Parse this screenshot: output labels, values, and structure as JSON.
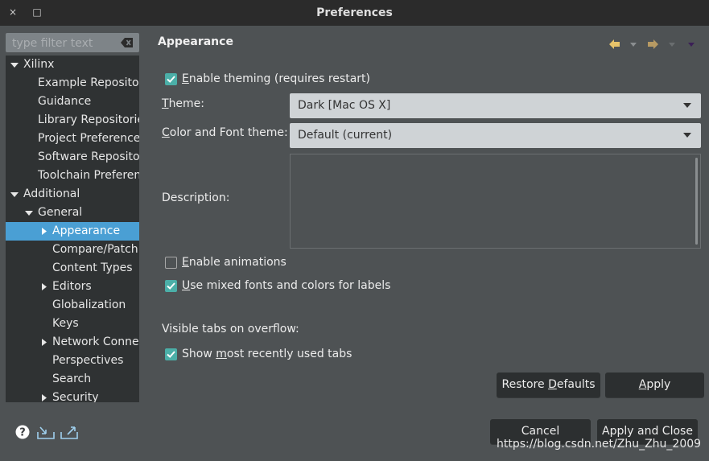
{
  "window": {
    "title": "Preferences",
    "close_symbol": "×",
    "max_symbol": "□"
  },
  "filter": {
    "placeholder": "type filter text"
  },
  "tree": [
    {
      "label": "Xilinx",
      "level": 0,
      "expander": "expanded"
    },
    {
      "label": "Example Repositor",
      "level": 1,
      "expander": "none"
    },
    {
      "label": "Guidance",
      "level": 1,
      "expander": "none"
    },
    {
      "label": "Library Repositorie",
      "level": 1,
      "expander": "none"
    },
    {
      "label": "Project Preference",
      "level": 1,
      "expander": "none"
    },
    {
      "label": "Software Reposito",
      "level": 1,
      "expander": "none"
    },
    {
      "label": "Toolchain Preferen",
      "level": 1,
      "expander": "none"
    },
    {
      "label": "Additional",
      "level": 0,
      "expander": "expanded"
    },
    {
      "label": "General",
      "level": 1,
      "expander": "expanded"
    },
    {
      "label": "Appearance",
      "level": 2,
      "expander": "collapsed",
      "selected": true
    },
    {
      "label": "Compare/Patch",
      "level": 2,
      "expander": "none"
    },
    {
      "label": "Content Types",
      "level": 2,
      "expander": "none"
    },
    {
      "label": "Editors",
      "level": 2,
      "expander": "collapsed"
    },
    {
      "label": "Globalization",
      "level": 2,
      "expander": "none"
    },
    {
      "label": "Keys",
      "level": 2,
      "expander": "none"
    },
    {
      "label": "Network Connec",
      "level": 2,
      "expander": "collapsed"
    },
    {
      "label": "Perspectives",
      "level": 2,
      "expander": "none"
    },
    {
      "label": "Search",
      "level": 2,
      "expander": "none"
    },
    {
      "label": "Security",
      "level": 2,
      "expander": "collapsed"
    }
  ],
  "page": {
    "title": "Appearance",
    "enable_theming": {
      "mnemonic": "E",
      "rest": "nable theming (requires restart)",
      "checked": true
    },
    "theme": {
      "mnemonic": "T",
      "rest": "heme:",
      "value": "Dark [Mac OS X]"
    },
    "color_font": {
      "mnemonic": "C",
      "rest": "olor and Font theme:",
      "value": "Default (current)"
    },
    "description_label": "Description:",
    "enable_animations": {
      "mnemonic": "E",
      "rest": "nable animations",
      "checked": false
    },
    "mixed_fonts": {
      "mnemonic": "U",
      "rest": "se mixed fonts and colors for labels",
      "checked": true
    },
    "visible_tabs_label": "Visible tabs on overflow:",
    "recent_tabs": {
      "pre": "Show ",
      "mnemonic": "m",
      "rest": "ost recently used tabs",
      "checked": true
    }
  },
  "buttons": {
    "restore_pre": "Restore ",
    "restore_mn": "D",
    "restore_rest": "efaults",
    "apply_mn": "A",
    "apply_rest": "pply",
    "cancel": "Cancel",
    "apply_close": "Apply and Close"
  },
  "icons": {
    "help": "help-icon",
    "import": "import-icon",
    "export": "export-icon",
    "back": "back-arrow-icon",
    "forward": "forward-arrow-icon",
    "menu": "view-menu-icon"
  },
  "colors": {
    "accent": "#4bafa8",
    "selection": "#4a9fd4",
    "nav_arrow": "#e8c46a"
  },
  "watermark": "https://blog.csdn.net/Zhu_Zhu_2009"
}
